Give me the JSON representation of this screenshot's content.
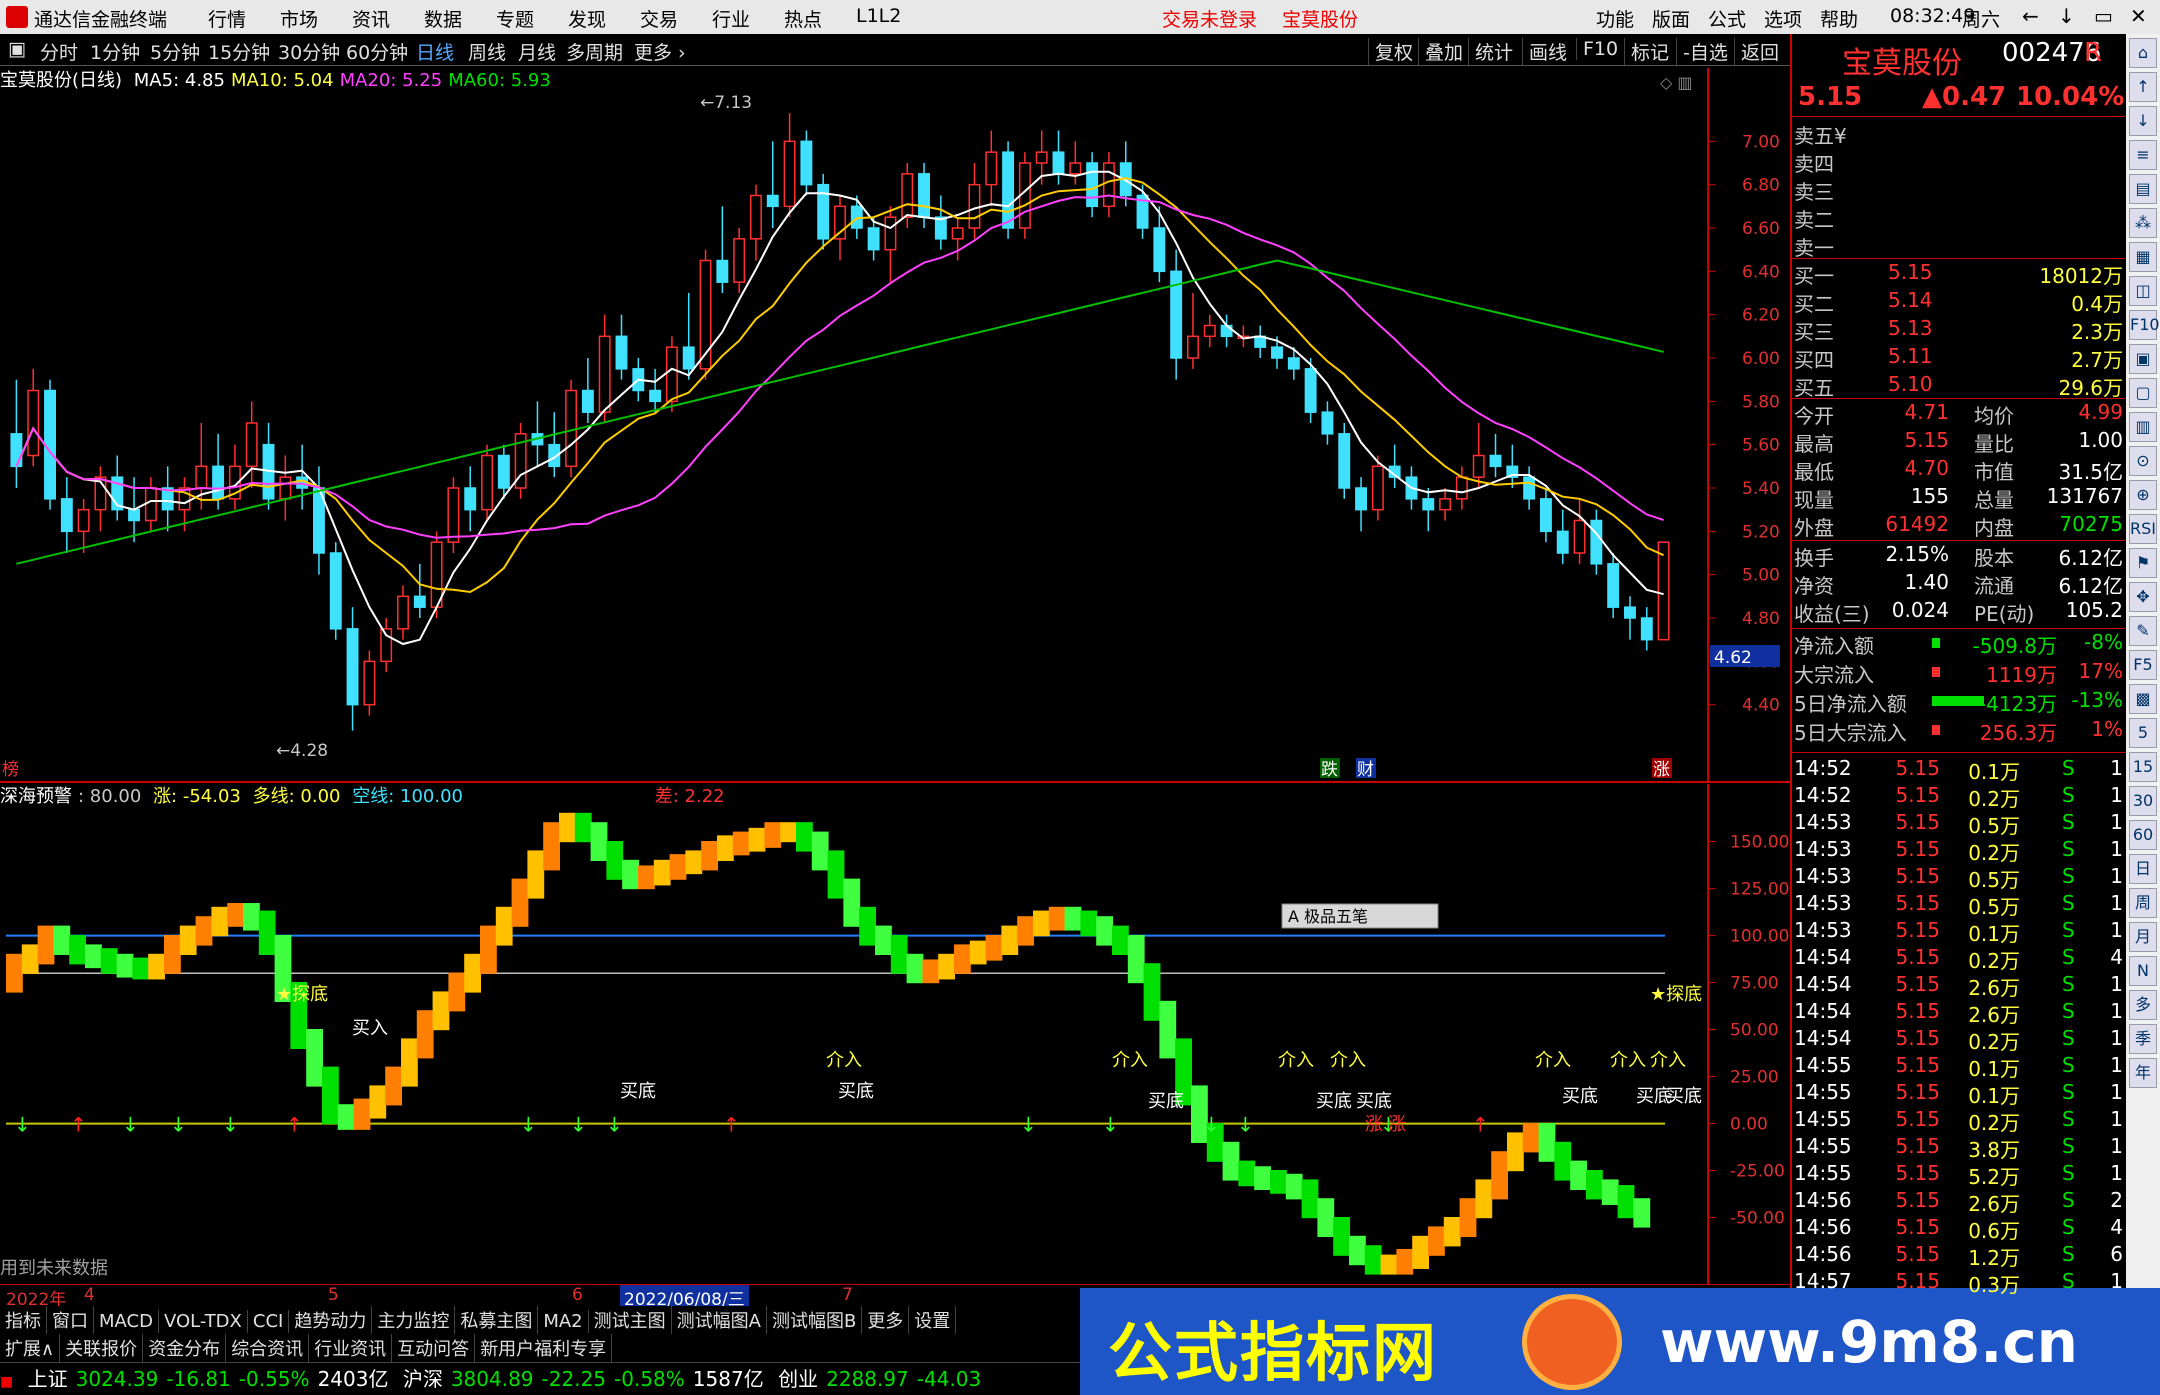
{
  "topbar": {
    "app_title": "通达信金融终端",
    "menus": [
      "行情",
      "市场",
      "资讯",
      "数据",
      "专题",
      "发现",
      "交易",
      "行业",
      "热点",
      "L1L2"
    ],
    "status_login": "交易未登录",
    "status_stock": "宝莫股份",
    "menus_right": [
      "功能",
      "版面",
      "公式",
      "选项",
      "帮助"
    ],
    "time": "08:32:49",
    "weekday": "周六",
    "win": [
      "←",
      "↓",
      "▭",
      "✕"
    ]
  },
  "toolbar": {
    "periods": [
      "分时",
      "1分钟",
      "5分钟",
      "15分钟",
      "30分钟",
      "60分钟",
      "日线",
      "周线",
      "月线",
      "多周期",
      "更多 ›"
    ],
    "active": "日线",
    "right": [
      "复权",
      "叠加",
      "统计",
      "画线",
      "F10",
      "标记",
      "-自选",
      "返回"
    ]
  },
  "legend": {
    "name": "宝莫股份(日线)",
    "ma5": "MA5: 4.85",
    "ma10": "MA10: 5.04",
    "ma20": "MA20: 5.25",
    "ma60": "MA60: 5.93",
    "arrow": "↑",
    "arrow_dn": "↓"
  },
  "main_axis": {
    "ticks": [
      "7.00",
      "6.80",
      "6.60",
      "6.40",
      "6.20",
      "6.00",
      "5.80",
      "5.60",
      "5.40",
      "5.20",
      "5.00",
      "4.80",
      "4.60",
      "4.40"
    ],
    "price_tag": "4.62",
    "high_label": "7.13",
    "low_label": "4.28",
    "marks": [
      "跌",
      "财",
      "涨"
    ],
    "left_mark": "榜"
  },
  "sub_legend": {
    "name": "深海预警",
    "val": ": 80.00",
    "zhang": "涨: -54.03",
    "duo": "多线: 0.00",
    "kong": "空线: 100.00",
    "cha": "差: 2.22"
  },
  "sub_axis": {
    "ticks": [
      "150.00",
      "125.00",
      "100.00",
      "75.00",
      "50.00",
      "25.00",
      "0.00",
      "-25.00",
      "-50.00"
    ]
  },
  "sub_labels": {
    "tandi": "★探底",
    "mairu": "买入",
    "jieru": "介入",
    "maidi": "买底",
    "zhang": "涨",
    "warn": "用到未来数据"
  },
  "popup": {
    "label": "极品五笔"
  },
  "axisbar": {
    "items": [
      "2022年",
      "4",
      "5",
      "6",
      "2022/06/08/三",
      "7"
    ]
  },
  "tabs1": [
    "指标",
    "窗口",
    "MACD",
    "VOL-TDX",
    "CCI",
    "趋势动力",
    "主力监控",
    "私募主图",
    "MA2",
    "测试主图",
    "测试幅图A",
    "测试幅图B",
    "更多",
    "设置"
  ],
  "tabs2": [
    "扩展∧",
    "关联报价",
    "资金分布",
    "综合资讯",
    "行业资讯",
    "互动问答",
    "新用户福利专享"
  ],
  "status": {
    "sh_name": "上证",
    "sh_val": "3024.39",
    "sh_chg": "-16.81",
    "sh_pct": "-0.55%",
    "sh_amt": "2403亿",
    "hs_name": "沪深",
    "hs_val": "3804.89",
    "hs_chg": "-22.25",
    "hs_pct": "-0.58%",
    "hs_amt": "1587亿",
    "cy_name": "创业",
    "cy_val": "2288.97",
    "cy_chg": "-44.03"
  },
  "banner": {
    "text1": "公式指标网",
    "text2": "www.9m8.cn"
  },
  "quote": {
    "name": "宝莫股份",
    "code": "002476",
    "r": "R",
    "price": "5.15",
    "chg": "▲0.47",
    "pct": "10.04%",
    "asks": [
      "卖五",
      "卖四",
      "卖三",
      "卖二",
      "卖一"
    ],
    "ask_suffix": "¥",
    "bids": [
      {
        "l": "买一",
        "p": "5.15",
        "v": "18012万"
      },
      {
        "l": "买二",
        "p": "5.14",
        "v": "0.4万"
      },
      {
        "l": "买三",
        "p": "5.13",
        "v": "2.3万"
      },
      {
        "l": "买四",
        "p": "5.11",
        "v": "2.7万"
      },
      {
        "l": "买五",
        "p": "5.10",
        "v": "29.6万"
      }
    ],
    "stats": [
      {
        "a": "今开",
        "av": "4.71",
        "b": "均价",
        "bv": "4.99"
      },
      {
        "a": "最高",
        "av": "5.15",
        "b": "量比",
        "bv": "1.00"
      },
      {
        "a": "最低",
        "av": "4.70",
        "b": "市值",
        "bv": "31.5亿"
      },
      {
        "a": "现量",
        "av": "155",
        "b": "总量",
        "bv": "131767"
      },
      {
        "a": "外盘",
        "av": "61492",
        "b": "内盘",
        "bv": "70275"
      }
    ],
    "stats2": [
      {
        "a": "换手",
        "av": "2.15%",
        "b": "股本",
        "bv": "6.12亿"
      },
      {
        "a": "净资",
        "av": "1.40",
        "b": "流通",
        "bv": "6.12亿"
      },
      {
        "a": "收益(三)",
        "av": "0.024",
        "b": "PE(动)",
        "bv": "105.2"
      }
    ],
    "flows": [
      {
        "l": "净流入额",
        "v": "-509.8万",
        "p": "-8%"
      },
      {
        "l": "大宗流入",
        "v": "1119万",
        "p": "17%"
      },
      {
        "l": "5日净流入额",
        "v": "-4123万",
        "p": "-13%"
      },
      {
        "l": "5日大宗流入",
        "v": "256.3万",
        "p": "1%"
      }
    ],
    "ticks": [
      [
        "14:52",
        "5.15",
        "0.1万",
        "S",
        "1"
      ],
      [
        "14:52",
        "5.15",
        "0.2万",
        "S",
        "1"
      ],
      [
        "14:53",
        "5.15",
        "0.5万",
        "S",
        "1"
      ],
      [
        "14:53",
        "5.15",
        "0.2万",
        "S",
        "1"
      ],
      [
        "14:53",
        "5.15",
        "0.5万",
        "S",
        "1"
      ],
      [
        "14:53",
        "5.15",
        "0.5万",
        "S",
        "1"
      ],
      [
        "14:53",
        "5.15",
        "0.1万",
        "S",
        "1"
      ],
      [
        "14:54",
        "5.15",
        "0.2万",
        "S",
        "4"
      ],
      [
        "14:54",
        "5.15",
        "2.6万",
        "S",
        "1"
      ],
      [
        "14:54",
        "5.15",
        "2.6万",
        "S",
        "1"
      ],
      [
        "14:54",
        "5.15",
        "0.2万",
        "S",
        "1"
      ],
      [
        "14:55",
        "5.15",
        "0.1万",
        "S",
        "1"
      ],
      [
        "14:55",
        "5.15",
        "0.1万",
        "S",
        "1"
      ],
      [
        "14:55",
        "5.15",
        "0.2万",
        "S",
        "1"
      ],
      [
        "14:55",
        "5.15",
        "3.8万",
        "S",
        "1"
      ],
      [
        "14:55",
        "5.15",
        "5.2万",
        "S",
        "1"
      ],
      [
        "14:56",
        "5.15",
        "2.6万",
        "S",
        "2"
      ],
      [
        "14:56",
        "5.15",
        "0.6万",
        "S",
        "4"
      ],
      [
        "14:56",
        "5.15",
        "1.2万",
        "S",
        "6"
      ],
      [
        "14:57",
        "5.15",
        "0.3万",
        "S",
        "1"
      ]
    ]
  },
  "sidebar": [
    "⌂",
    "↑",
    "↓",
    "≡",
    "▤",
    "⁂",
    "▦",
    "◫",
    "F10",
    "▣",
    "▢",
    "▥",
    "⊙",
    "⊕",
    "RSI",
    "⚑",
    "✥",
    "✎",
    "F5",
    "▩",
    "5",
    "15",
    "30",
    "60",
    "日",
    "周",
    "月",
    "N",
    "多",
    "季",
    "年"
  ],
  "chart_data": {
    "type": "candlestick",
    "title": "宝莫股份(日线)",
    "ylim": [
      4.2,
      7.2
    ],
    "candles": [
      [
        5.65,
        5.9,
        5.4,
        5.5
      ],
      [
        5.55,
        5.95,
        5.5,
        5.85
      ],
      [
        5.85,
        5.9,
        5.3,
        5.35
      ],
      [
        5.35,
        5.45,
        5.1,
        5.2
      ],
      [
        5.2,
        5.35,
        5.1,
        5.3
      ],
      [
        5.3,
        5.5,
        5.2,
        5.45
      ],
      [
        5.45,
        5.55,
        5.25,
        5.3
      ],
      [
        5.3,
        5.45,
        5.15,
        5.25
      ],
      [
        5.25,
        5.45,
        5.2,
        5.4
      ],
      [
        5.4,
        5.5,
        5.2,
        5.3
      ],
      [
        5.3,
        5.45,
        5.2,
        5.4
      ],
      [
        5.4,
        5.7,
        5.3,
        5.5
      ],
      [
        5.5,
        5.65,
        5.3,
        5.35
      ],
      [
        5.35,
        5.6,
        5.3,
        5.5
      ],
      [
        5.5,
        5.8,
        5.4,
        5.7
      ],
      [
        5.6,
        5.7,
        5.3,
        5.35
      ],
      [
        5.35,
        5.55,
        5.25,
        5.45
      ],
      [
        5.45,
        5.6,
        5.3,
        5.4
      ],
      [
        5.4,
        5.5,
        5.0,
        5.1
      ],
      [
        5.1,
        5.15,
        4.7,
        4.75
      ],
      [
        4.75,
        4.85,
        4.28,
        4.4
      ],
      [
        4.4,
        4.65,
        4.35,
        4.6
      ],
      [
        4.6,
        4.8,
        4.55,
        4.75
      ],
      [
        4.75,
        4.95,
        4.7,
        4.9
      ],
      [
        4.9,
        5.05,
        4.8,
        4.85
      ],
      [
        4.85,
        5.2,
        4.8,
        5.15
      ],
      [
        5.15,
        5.45,
        5.1,
        5.4
      ],
      [
        5.4,
        5.5,
        5.2,
        5.3
      ],
      [
        5.3,
        5.6,
        5.25,
        5.55
      ],
      [
        5.55,
        5.6,
        5.35,
        5.4
      ],
      [
        5.4,
        5.7,
        5.35,
        5.65
      ],
      [
        5.65,
        5.8,
        5.5,
        5.6
      ],
      [
        5.6,
        5.75,
        5.45,
        5.5
      ],
      [
        5.5,
        5.9,
        5.45,
        5.85
      ],
      [
        5.85,
        6.0,
        5.7,
        5.75
      ],
      [
        5.75,
        6.2,
        5.7,
        6.1
      ],
      [
        6.1,
        6.2,
        5.9,
        5.95
      ],
      [
        5.95,
        6.0,
        5.8,
        5.85
      ],
      [
        5.85,
        5.95,
        5.75,
        5.8
      ],
      [
        5.8,
        6.1,
        5.75,
        6.05
      ],
      [
        6.05,
        6.3,
        5.9,
        5.95
      ],
      [
        5.95,
        6.5,
        5.9,
        6.45
      ],
      [
        6.45,
        6.7,
        6.3,
        6.35
      ],
      [
        6.35,
        6.6,
        6.3,
        6.55
      ],
      [
        6.55,
        6.8,
        6.45,
        6.75
      ],
      [
        6.75,
        7.0,
        6.6,
        6.7
      ],
      [
        6.7,
        7.13,
        6.65,
        7.0
      ],
      [
        7.0,
        7.05,
        6.75,
        6.8
      ],
      [
        6.8,
        6.85,
        6.5,
        6.55
      ],
      [
        6.55,
        6.75,
        6.45,
        6.7
      ],
      [
        6.7,
        6.75,
        6.55,
        6.6
      ],
      [
        6.6,
        6.65,
        6.45,
        6.5
      ],
      [
        6.5,
        6.7,
        6.35,
        6.65
      ],
      [
        6.65,
        6.9,
        6.6,
        6.85
      ],
      [
        6.85,
        6.9,
        6.6,
        6.65
      ],
      [
        6.65,
        6.75,
        6.5,
        6.55
      ],
      [
        6.55,
        6.65,
        6.45,
        6.6
      ],
      [
        6.6,
        6.9,
        6.55,
        6.8
      ],
      [
        6.8,
        7.05,
        6.7,
        6.95
      ],
      [
        6.95,
        7.0,
        6.55,
        6.6
      ],
      [
        6.6,
        6.95,
        6.55,
        6.9
      ],
      [
        6.9,
        7.05,
        6.8,
        6.95
      ],
      [
        6.95,
        7.05,
        6.8,
        6.85
      ],
      [
        6.85,
        7.0,
        6.8,
        6.9
      ],
      [
        6.9,
        6.95,
        6.65,
        6.7
      ],
      [
        6.7,
        6.95,
        6.65,
        6.9
      ],
      [
        6.9,
        7.0,
        6.7,
        6.75
      ],
      [
        6.75,
        6.8,
        6.55,
        6.6
      ],
      [
        6.6,
        6.7,
        6.35,
        6.4
      ],
      [
        6.4,
        6.5,
        5.9,
        6.0
      ],
      [
        6.0,
        6.3,
        5.95,
        6.1
      ],
      [
        6.1,
        6.2,
        6.05,
        6.15
      ],
      [
        6.15,
        6.2,
        6.05,
        6.1
      ],
      [
        6.1,
        6.15,
        6.05,
        6.1
      ],
      [
        6.1,
        6.15,
        6.0,
        6.05
      ],
      [
        6.05,
        6.1,
        5.95,
        6.0
      ],
      [
        6.0,
        6.05,
        5.9,
        5.95
      ],
      [
        5.95,
        6.0,
        5.7,
        5.75
      ],
      [
        5.75,
        5.8,
        5.6,
        5.65
      ],
      [
        5.65,
        5.7,
        5.35,
        5.4
      ],
      [
        5.4,
        5.45,
        5.2,
        5.3
      ],
      [
        5.3,
        5.55,
        5.25,
        5.5
      ],
      [
        5.5,
        5.6,
        5.4,
        5.45
      ],
      [
        5.45,
        5.5,
        5.3,
        5.35
      ],
      [
        5.35,
        5.4,
        5.2,
        5.3
      ],
      [
        5.3,
        5.4,
        5.25,
        5.35
      ],
      [
        5.35,
        5.5,
        5.3,
        5.45
      ],
      [
        5.45,
        5.7,
        5.4,
        5.55
      ],
      [
        5.55,
        5.65,
        5.45,
        5.5
      ],
      [
        5.5,
        5.6,
        5.4,
        5.45
      ],
      [
        5.45,
        5.5,
        5.3,
        5.35
      ],
      [
        5.35,
        5.4,
        5.15,
        5.2
      ],
      [
        5.2,
        5.3,
        5.05,
        5.1
      ],
      [
        5.1,
        5.35,
        5.05,
        5.25
      ],
      [
        5.25,
        5.3,
        5.0,
        5.05
      ],
      [
        5.05,
        5.1,
        4.8,
        4.85
      ],
      [
        4.85,
        4.9,
        4.7,
        4.8
      ],
      [
        4.8,
        4.85,
        4.65,
        4.7
      ],
      [
        4.7,
        5.15,
        4.7,
        5.15
      ]
    ],
    "ma": [
      {
        "name": "MA5",
        "color": "#ffffff"
      },
      {
        "name": "MA10",
        "color": "#ffcc00"
      },
      {
        "name": "MA20",
        "color": "#ff40ff"
      },
      {
        "name": "MA60",
        "color": "#00c000"
      }
    ],
    "indicator": {
      "name": "深海预警",
      "ylim": [
        -80,
        170
      ],
      "values": [
        75,
        85,
        90,
        100,
        95,
        90,
        88,
        85,
        83,
        82,
        85,
        95,
        100,
        105,
        110,
        112,
        108,
        95,
        70,
        45,
        25,
        5,
        2,
        8,
        15,
        25,
        40,
        55,
        65,
        75,
        85,
        100,
        110,
        125,
        140,
        155,
        160,
        155,
        145,
        135,
        130,
        132,
        135,
        138,
        140,
        145,
        148,
        150,
        152,
        155,
        155,
        150,
        140,
        125,
        110,
        100,
        95,
        85,
        80,
        82,
        85,
        90,
        92,
        95,
        100,
        105,
        108,
        110,
        108,
        105,
        100,
        95,
        80,
        60,
        40,
        15,
        -5,
        -15,
        -25,
        -28,
        -30,
        -32,
        -35,
        -45,
        -55,
        -65,
        -70,
        -75,
        -75,
        -72,
        -65,
        -60,
        -55,
        -45,
        -35,
        -20,
        -10,
        -5,
        -15,
        -25,
        -30,
        -35,
        -38,
        -45,
        -50
      ]
    }
  }
}
